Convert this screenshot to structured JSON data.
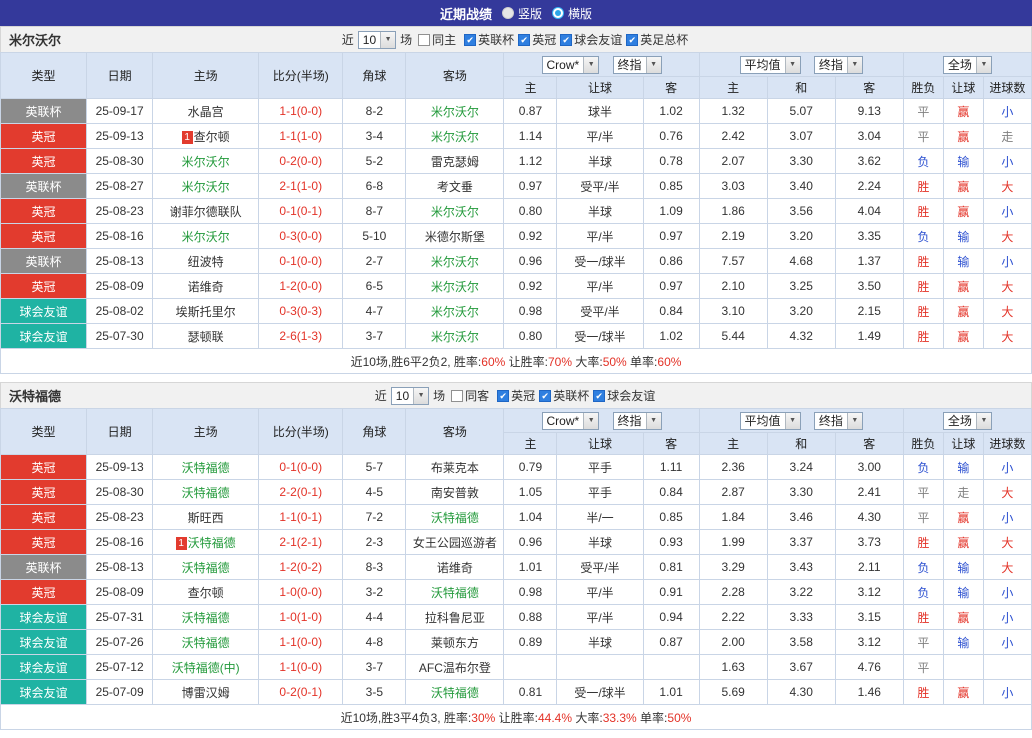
{
  "topbar": {
    "title": "近期战绩",
    "vertical_label": "竖版",
    "horizontal_label": "横版",
    "selected_layout": "横版"
  },
  "columns": {
    "league": "类型",
    "date": "日期",
    "home": "主场",
    "score": "比分(半场)",
    "corners": "角球",
    "away": "客场",
    "asia_home": "主",
    "asia_handicap": "让球",
    "asia_away": "客",
    "euro_home": "主",
    "euro_draw": "和",
    "euro_away": "客",
    "outcome": "胜负",
    "handicap_outcome": "让球",
    "goals": "进球数"
  },
  "odds_header": {
    "asia_company": "Crow*",
    "asia_stage": "终指",
    "euro_company": "平均值",
    "euro_stage": "终指",
    "scope": "全场"
  },
  "colors": {
    "topbar_bg": "#34399b",
    "header_bg": "#d9e4f4",
    "leagues": {
      "英联杯": "#8b8b8b",
      "英冠": "#e23b2e",
      "球会友谊": "#1fb3a3"
    },
    "focus_team": "#239a3b",
    "score_red": "#e33227",
    "win_red": "#e33227",
    "loss_blue": "#2b4fd0",
    "draw_gray": "#808080",
    "checkbox_blue": "#2f7fe0"
  },
  "sections": [
    {
      "team": "米尔沃尔",
      "filter": {
        "near_label": "近",
        "count": "10",
        "field_label": "场",
        "same_label": "同主",
        "leagues": [
          "英联杯",
          "英冠",
          "球会友谊",
          "英足总杯"
        ]
      },
      "rows": [
        {
          "league": "英联杯",
          "date": "25-09-17",
          "home": "水晶宫",
          "home_is_focus": false,
          "home_red_card": "",
          "score": "1-1(0-0)",
          "corners": "8-2",
          "away": "米尔沃尔",
          "away_is_focus": true,
          "away_red_card": "",
          "asia_home": "0.87",
          "asia_handicap": "球半",
          "asia_away": "1.02",
          "euro_home": "1.32",
          "euro_draw": "5.07",
          "euro_away": "9.13",
          "outcome": "平",
          "handicap_outcome": "赢",
          "goals_outcome": "小"
        },
        {
          "league": "英冠",
          "date": "25-09-13",
          "home": "查尔顿",
          "home_is_focus": false,
          "home_red_card": "1",
          "score": "1-1(1-0)",
          "corners": "3-4",
          "away": "米尔沃尔",
          "away_is_focus": true,
          "away_red_card": "",
          "asia_home": "1.14",
          "asia_handicap": "平/半",
          "asia_away": "0.76",
          "euro_home": "2.42",
          "euro_draw": "3.07",
          "euro_away": "3.04",
          "outcome": "平",
          "handicap_outcome": "赢",
          "goals_outcome": "走"
        },
        {
          "league": "英冠",
          "date": "25-08-30",
          "home": "米尔沃尔",
          "home_is_focus": true,
          "home_red_card": "",
          "score": "0-2(0-0)",
          "corners": "5-2",
          "away": "雷克瑟姆",
          "away_is_focus": false,
          "away_red_card": "",
          "asia_home": "1.12",
          "asia_handicap": "半球",
          "asia_away": "0.78",
          "euro_home": "2.07",
          "euro_draw": "3.30",
          "euro_away": "3.62",
          "outcome": "负",
          "handicap_outcome": "输",
          "goals_outcome": "小"
        },
        {
          "league": "英联杯",
          "date": "25-08-27",
          "home": "米尔沃尔",
          "home_is_focus": true,
          "home_red_card": "",
          "score": "2-1(1-0)",
          "corners": "6-8",
          "away": "考文垂",
          "away_is_focus": false,
          "away_red_card": "",
          "asia_home": "0.97",
          "asia_handicap": "受平/半",
          "asia_away": "0.85",
          "euro_home": "3.03",
          "euro_draw": "3.40",
          "euro_away": "2.24",
          "outcome": "胜",
          "handicap_outcome": "赢",
          "goals_outcome": "大"
        },
        {
          "league": "英冠",
          "date": "25-08-23",
          "home": "谢菲尔德联队",
          "home_is_focus": false,
          "home_red_card": "",
          "score": "0-1(0-1)",
          "corners": "8-7",
          "away": "米尔沃尔",
          "away_is_focus": true,
          "away_red_card": "",
          "asia_home": "0.80",
          "asia_handicap": "半球",
          "asia_away": "1.09",
          "euro_home": "1.86",
          "euro_draw": "3.56",
          "euro_away": "4.04",
          "outcome": "胜",
          "handicap_outcome": "赢",
          "goals_outcome": "小"
        },
        {
          "league": "英冠",
          "date": "25-08-16",
          "home": "米尔沃尔",
          "home_is_focus": true,
          "home_red_card": "",
          "score": "0-3(0-0)",
          "corners": "5-10",
          "away": "米德尔斯堡",
          "away_is_focus": false,
          "away_red_card": "",
          "asia_home": "0.92",
          "asia_handicap": "平/半",
          "asia_away": "0.97",
          "euro_home": "2.19",
          "euro_draw": "3.20",
          "euro_away": "3.35",
          "outcome": "负",
          "handicap_outcome": "输",
          "goals_outcome": "大"
        },
        {
          "league": "英联杯",
          "date": "25-08-13",
          "home": "纽波特",
          "home_is_focus": false,
          "home_red_card": "",
          "score": "0-1(0-0)",
          "corners": "2-7",
          "away": "米尔沃尔",
          "away_is_focus": true,
          "away_red_card": "",
          "asia_home": "0.96",
          "asia_handicap": "受一/球半",
          "asia_away": "0.86",
          "euro_home": "7.57",
          "euro_draw": "4.68",
          "euro_away": "1.37",
          "outcome": "胜",
          "handicap_outcome": "输",
          "goals_outcome": "小"
        },
        {
          "league": "英冠",
          "date": "25-08-09",
          "home": "诺维奇",
          "home_is_focus": false,
          "home_red_card": "",
          "score": "1-2(0-0)",
          "corners": "6-5",
          "away": "米尔沃尔",
          "away_is_focus": true,
          "away_red_card": "",
          "asia_home": "0.92",
          "asia_handicap": "平/半",
          "asia_away": "0.97",
          "euro_home": "2.10",
          "euro_draw": "3.25",
          "euro_away": "3.50",
          "outcome": "胜",
          "handicap_outcome": "赢",
          "goals_outcome": "大"
        },
        {
          "league": "球会友谊",
          "date": "25-08-02",
          "home": "埃斯托里尔",
          "home_is_focus": false,
          "home_red_card": "",
          "score": "0-3(0-3)",
          "corners": "4-7",
          "away": "米尔沃尔",
          "away_is_focus": true,
          "away_red_card": "",
          "asia_home": "0.98",
          "asia_handicap": "受平/半",
          "asia_away": "0.84",
          "euro_home": "3.10",
          "euro_draw": "3.20",
          "euro_away": "2.15",
          "outcome": "胜",
          "handicap_outcome": "赢",
          "goals_outcome": "大"
        },
        {
          "league": "球会友谊",
          "date": "25-07-30",
          "home": "瑟顿联",
          "home_is_focus": false,
          "home_red_card": "",
          "score": "2-6(1-3)",
          "corners": "3-7",
          "away": "米尔沃尔",
          "away_is_focus": true,
          "away_red_card": "",
          "asia_home": "0.80",
          "asia_handicap": "受一/球半",
          "asia_away": "1.02",
          "euro_home": "5.44",
          "euro_draw": "4.32",
          "euro_away": "1.49",
          "outcome": "胜",
          "handicap_outcome": "赢",
          "goals_outcome": "大"
        }
      ],
      "summary": [
        {
          "text": "近10场,胜6平2负2, 胜率:",
          "value": "60%"
        },
        {
          "text": " 让胜率:",
          "value": "70%"
        },
        {
          "text": " 大率:",
          "value": "50%"
        },
        {
          "text": " 单率:",
          "value": "60%"
        }
      ]
    },
    {
      "team": "沃特福德",
      "filter": {
        "near_label": "近",
        "count": "10",
        "field_label": "场",
        "same_label": "同客",
        "leagues": [
          "英冠",
          "英联杯",
          "球会友谊"
        ]
      },
      "rows": [
        {
          "league": "英冠",
          "date": "25-09-13",
          "home": "沃特福德",
          "home_is_focus": true,
          "home_red_card": "",
          "score": "0-1(0-0)",
          "corners": "5-7",
          "away": "布莱克本",
          "away_is_focus": false,
          "away_red_card": "",
          "asia_home": "0.79",
          "asia_handicap": "平手",
          "asia_away": "1.11",
          "euro_home": "2.36",
          "euro_draw": "3.24",
          "euro_away": "3.00",
          "outcome": "负",
          "handicap_outcome": "输",
          "goals_outcome": "小"
        },
        {
          "league": "英冠",
          "date": "25-08-30",
          "home": "沃特福德",
          "home_is_focus": true,
          "home_red_card": "",
          "score": "2-2(0-1)",
          "corners": "4-5",
          "away": "南安普敦",
          "away_is_focus": false,
          "away_red_card": "",
          "asia_home": "1.05",
          "asia_handicap": "平手",
          "asia_away": "0.84",
          "euro_home": "2.87",
          "euro_draw": "3.30",
          "euro_away": "2.41",
          "outcome": "平",
          "handicap_outcome": "走",
          "goals_outcome": "大"
        },
        {
          "league": "英冠",
          "date": "25-08-23",
          "home": "斯旺西",
          "home_is_focus": false,
          "home_red_card": "",
          "score": "1-1(0-1)",
          "corners": "7-2",
          "away": "沃特福德",
          "away_is_focus": true,
          "away_red_card": "",
          "asia_home": "1.04",
          "asia_handicap": "半/一",
          "asia_away": "0.85",
          "euro_home": "1.84",
          "euro_draw": "3.46",
          "euro_away": "4.30",
          "outcome": "平",
          "handicap_outcome": "赢",
          "goals_outcome": "小"
        },
        {
          "league": "英冠",
          "date": "25-08-16",
          "home": "沃特福德",
          "home_is_focus": true,
          "home_red_card": "1",
          "score": "2-1(2-1)",
          "corners": "2-3",
          "away": "女王公园巡游者",
          "away_is_focus": false,
          "away_red_card": "",
          "asia_home": "0.96",
          "asia_handicap": "半球",
          "asia_away": "0.93",
          "euro_home": "1.99",
          "euro_draw": "3.37",
          "euro_away": "3.73",
          "outcome": "胜",
          "handicap_outcome": "赢",
          "goals_outcome": "大"
        },
        {
          "league": "英联杯",
          "date": "25-08-13",
          "home": "沃特福德",
          "home_is_focus": true,
          "home_red_card": "",
          "score": "1-2(0-2)",
          "corners": "8-3",
          "away": "诺维奇",
          "away_is_focus": false,
          "away_red_card": "",
          "asia_home": "1.01",
          "asia_handicap": "受平/半",
          "asia_away": "0.81",
          "euro_home": "3.29",
          "euro_draw": "3.43",
          "euro_away": "2.11",
          "outcome": "负",
          "handicap_outcome": "输",
          "goals_outcome": "大"
        },
        {
          "league": "英冠",
          "date": "25-08-09",
          "home": "查尔顿",
          "home_is_focus": false,
          "home_red_card": "",
          "score": "1-0(0-0)",
          "corners": "3-2",
          "away": "沃特福德",
          "away_is_focus": true,
          "away_red_card": "",
          "asia_home": "0.98",
          "asia_handicap": "平/半",
          "asia_away": "0.91",
          "euro_home": "2.28",
          "euro_draw": "3.22",
          "euro_away": "3.12",
          "outcome": "负",
          "handicap_outcome": "输",
          "goals_outcome": "小"
        },
        {
          "league": "球会友谊",
          "date": "25-07-31",
          "home": "沃特福德",
          "home_is_focus": true,
          "home_red_card": "",
          "score": "1-0(1-0)",
          "corners": "4-4",
          "away": "拉科鲁尼亚",
          "away_is_focus": false,
          "away_red_card": "",
          "asia_home": "0.88",
          "asia_handicap": "平/半",
          "asia_away": "0.94",
          "euro_home": "2.22",
          "euro_draw": "3.33",
          "euro_away": "3.15",
          "outcome": "胜",
          "handicap_outcome": "赢",
          "goals_outcome": "小"
        },
        {
          "league": "球会友谊",
          "date": "25-07-26",
          "home": "沃特福德",
          "home_is_focus": true,
          "home_red_card": "",
          "score": "1-1(0-0)",
          "corners": "4-8",
          "away": "莱顿东方",
          "away_is_focus": false,
          "away_red_card": "",
          "asia_home": "0.89",
          "asia_handicap": "半球",
          "asia_away": "0.87",
          "euro_home": "2.00",
          "euro_draw": "3.58",
          "euro_away": "3.12",
          "outcome": "平",
          "handicap_outcome": "输",
          "goals_outcome": "小"
        },
        {
          "league": "球会友谊",
          "date": "25-07-12",
          "home": "沃特福德(中)",
          "home_is_focus": true,
          "home_red_card": "",
          "score": "1-1(0-0)",
          "corners": "3-7",
          "away": "AFC温布尔登",
          "away_is_focus": false,
          "away_red_card": "",
          "asia_home": "",
          "asia_handicap": "",
          "asia_away": "",
          "euro_home": "1.63",
          "euro_draw": "3.67",
          "euro_away": "4.76",
          "outcome": "平",
          "handicap_outcome": "",
          "goals_outcome": ""
        },
        {
          "league": "球会友谊",
          "date": "25-07-09",
          "home": "博雷汉姆",
          "home_is_focus": false,
          "home_red_card": "",
          "score": "0-2(0-1)",
          "corners": "3-5",
          "away": "沃特福德",
          "away_is_focus": true,
          "away_red_card": "",
          "asia_home": "0.81",
          "asia_handicap": "受一/球半",
          "asia_away": "1.01",
          "euro_home": "5.69",
          "euro_draw": "4.30",
          "euro_away": "1.46",
          "outcome": "胜",
          "handicap_outcome": "赢",
          "goals_outcome": "小"
        }
      ],
      "summary": [
        {
          "text": "近10场,胜3平4负3, 胜率:",
          "value": "30%"
        },
        {
          "text": " 让胜率:",
          "value": "44.4%"
        },
        {
          "text": " 大率:",
          "value": "33.3%"
        },
        {
          "text": " 单率:",
          "value": "50%"
        }
      ]
    }
  ]
}
